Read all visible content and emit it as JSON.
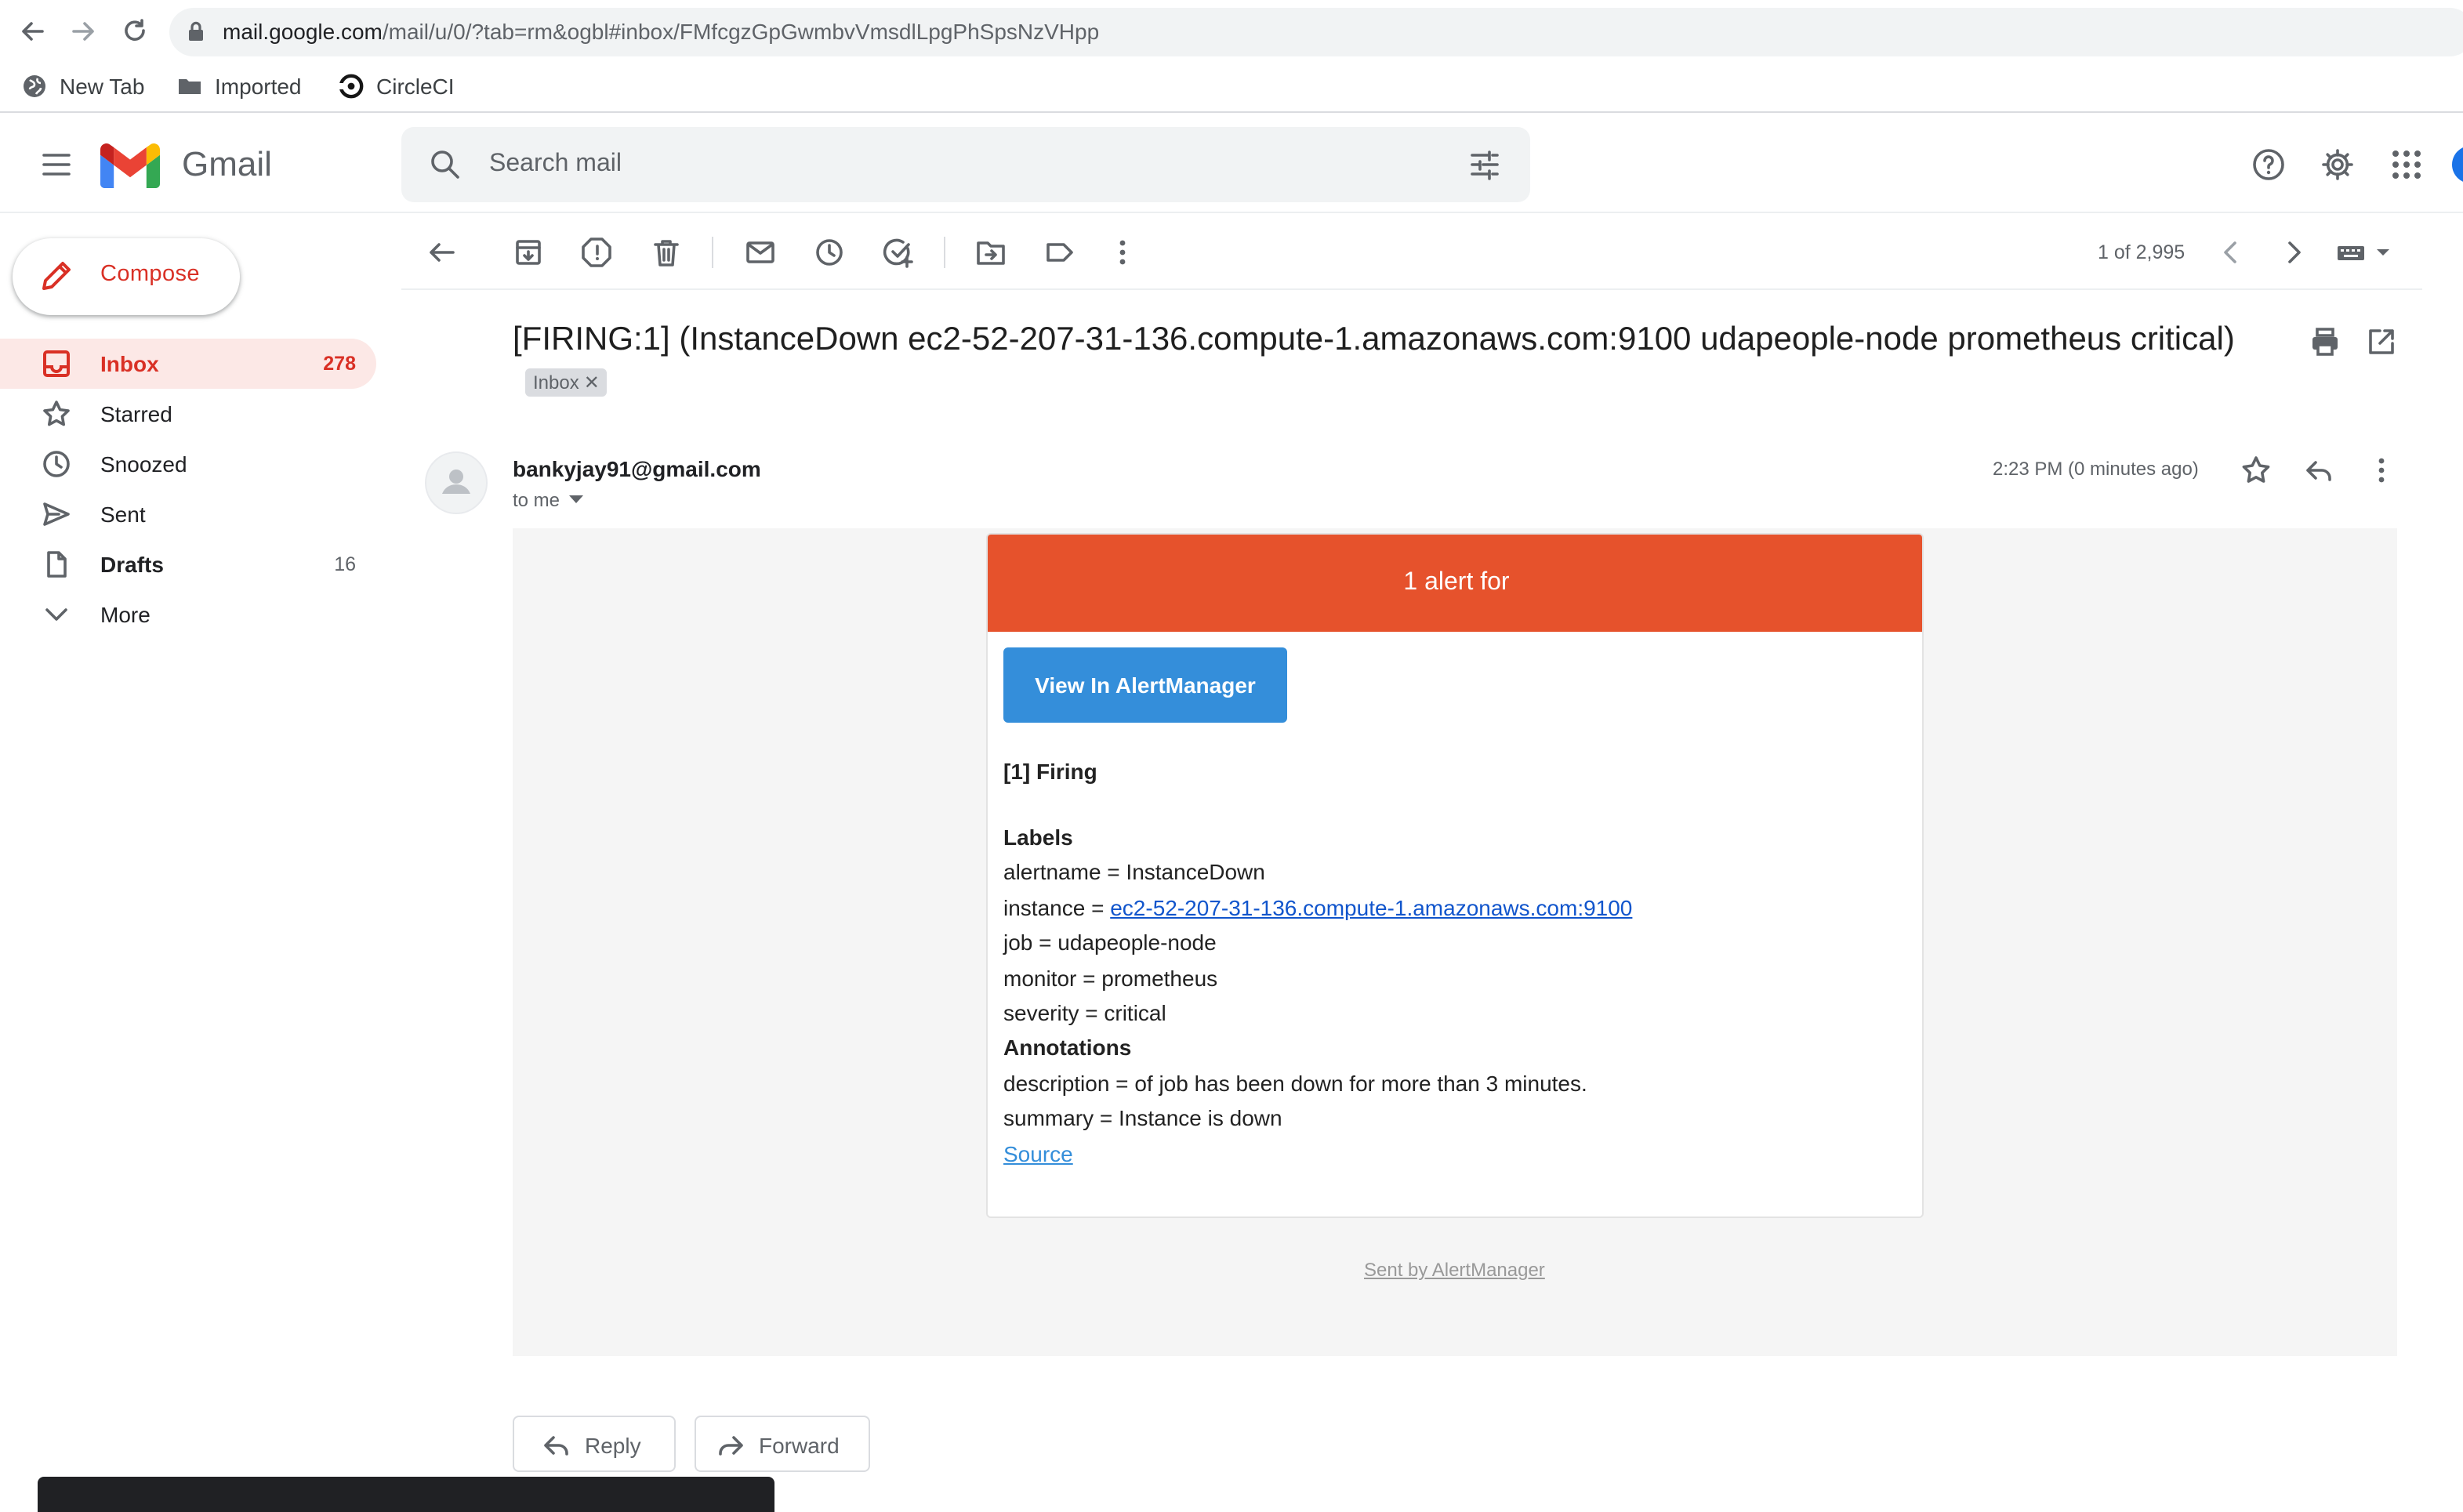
{
  "browser": {
    "url_host": "mail.google.com",
    "url_path": "/mail/u/0/?tab=rm&ogbl#inbox/FMfcgzGpGwmbvVmsdlLpgPhSpsNzVHpp",
    "bookmarks": [
      {
        "label": "New Tab",
        "icon": "globe-icon"
      },
      {
        "label": "Imported",
        "icon": "folder-icon"
      },
      {
        "label": "CircleCI",
        "icon": "circleci-icon"
      }
    ]
  },
  "header": {
    "brand": "Gmail",
    "search_placeholder": "Search mail"
  },
  "sidebar": {
    "compose_label": "Compose",
    "items": [
      {
        "label": "Inbox",
        "count": "278",
        "icon": "inbox-icon"
      },
      {
        "label": "Starred",
        "count": "",
        "icon": "star-icon"
      },
      {
        "label": "Snoozed",
        "count": "",
        "icon": "clock-icon"
      },
      {
        "label": "Sent",
        "count": "",
        "icon": "send-icon"
      },
      {
        "label": "Drafts",
        "count": "16",
        "icon": "file-icon"
      },
      {
        "label": "More",
        "count": "",
        "icon": "chevron-down-icon"
      }
    ]
  },
  "toolbar": {
    "pager": "1 of 2,995"
  },
  "message": {
    "subject": "[FIRING:1] (InstanceDown ec2-52-207-31-136.compute-1.amazonaws.com:9100 udapeople-node prometheus critical)",
    "label_chip": "Inbox",
    "sender": "bankyjay91@gmail.com",
    "recipient": "to me",
    "timestamp": "2:23 PM (0 minutes ago)"
  },
  "alert": {
    "banner": "1 alert for",
    "button": "View In AlertManager",
    "firing_heading": "[1] Firing",
    "labels_heading": "Labels",
    "alertname": "alertname = InstanceDown",
    "instance_prefix": "instance = ",
    "instance_link": "ec2-52-207-31-136.compute-1.amazonaws.com:9100",
    "job": "job = udapeople-node",
    "monitor": "monitor = prometheus",
    "severity": "severity = critical",
    "annotations_heading": "Annotations",
    "description": "description = of job has been down for more than 3 minutes.",
    "summary": "summary = Instance is down",
    "source_link": "Source",
    "footer": "Sent by AlertManager"
  },
  "actions": {
    "reply": "Reply",
    "forward": "Forward"
  },
  "colors": {
    "alert_banner": "#e6522c",
    "alertmanager_button": "#348eda",
    "gmail_red": "#d93025",
    "inbox_active_bg": "#fce8e6"
  }
}
